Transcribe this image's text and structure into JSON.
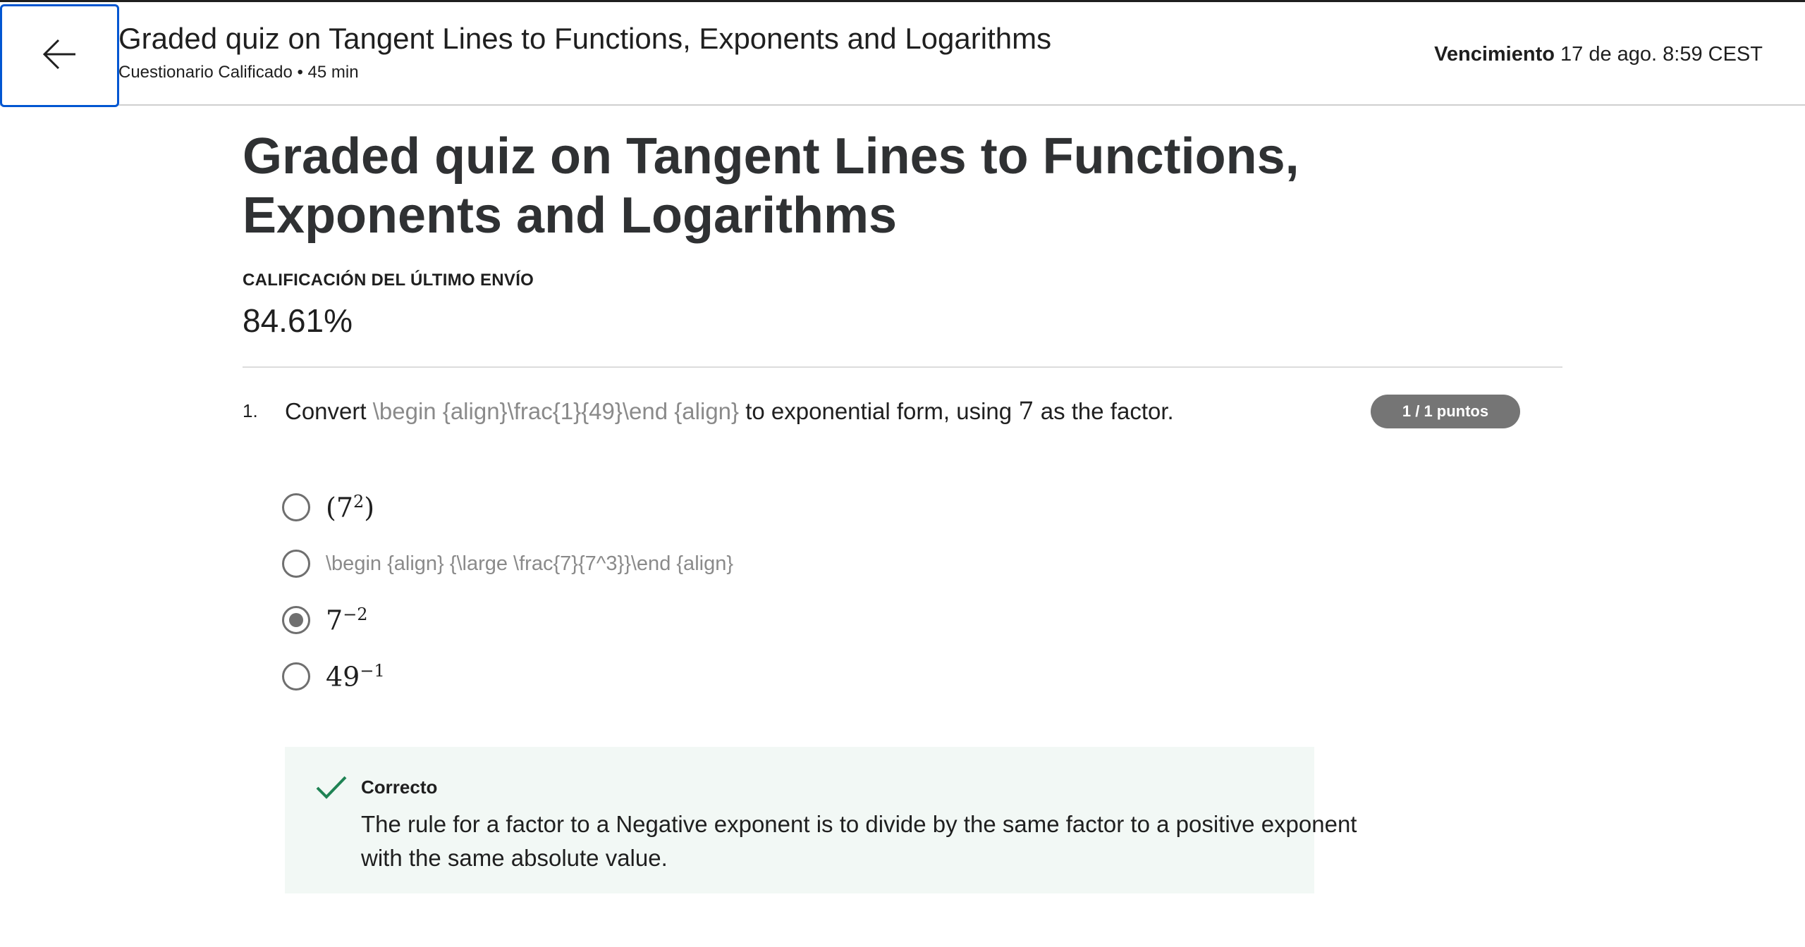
{
  "header": {
    "title": "Graded quiz on Tangent Lines to Functions, Exponents and Logarithms",
    "meta": "Cuestionario Calificado • 45 min",
    "due_label": "Vencimiento",
    "due_value": "17 de ago. 8:59 CEST"
  },
  "main": {
    "title": "Graded quiz on Tangent Lines to Functions, Exponents and Logarithms",
    "grade_label": "CALIFICACIÓN DEL ÚLTIMO ENVÍO",
    "grade_value": "84.61%"
  },
  "question": {
    "number": "1.",
    "text_before": "Convert ",
    "latex": "\\begin {align}\\frac{1}{49}\\end {align}",
    "text_middle": " to exponential form, using ",
    "factor": "7",
    "text_after": " as the factor.",
    "points": "1 / 1 puntos",
    "options": [
      {
        "base": "(7",
        "exp": "2",
        "close": ")",
        "selected": false
      },
      {
        "latex": "\\begin {align} {\\large \\frac{7}{7^3}}\\end {align}",
        "selected": false
      },
      {
        "base": "7",
        "exp": "−2",
        "selected": true
      },
      {
        "base": "49",
        "exp": "−1",
        "selected": false
      }
    ]
  },
  "feedback": {
    "status": "Correcto",
    "text": "The rule for a factor to a Negative exponent is to divide by the same factor to a positive exponent with the same absolute value.",
    "color": "#1f8354"
  }
}
